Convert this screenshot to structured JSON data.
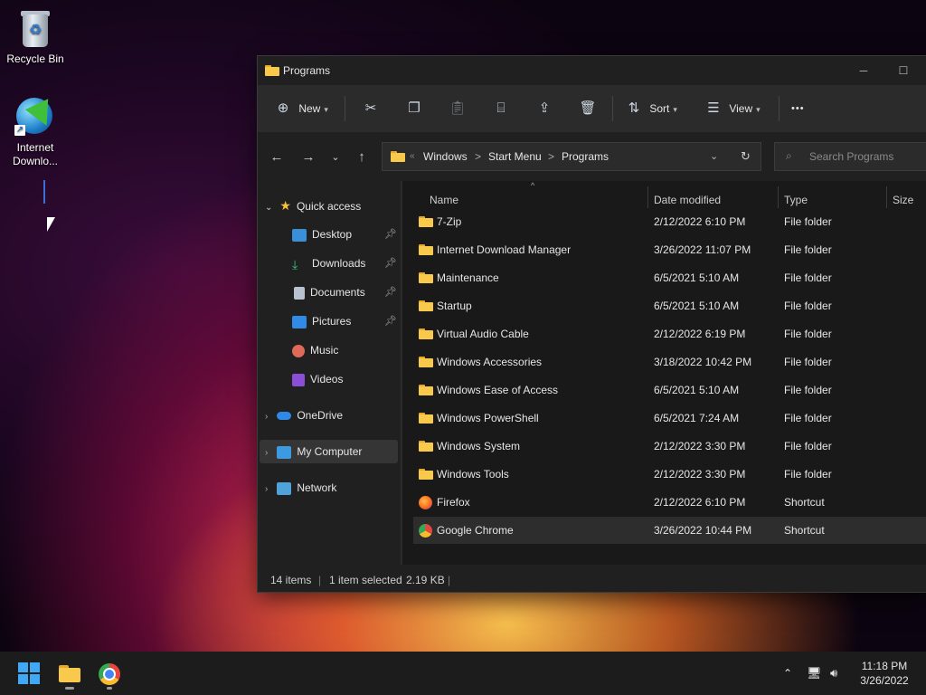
{
  "desktop": {
    "icons": [
      {
        "label": "Recycle Bin"
      },
      {
        "label": "Internet Downlo..."
      }
    ]
  },
  "window": {
    "title": "Programs",
    "toolbar": {
      "new_label": "New",
      "sort_label": "Sort",
      "view_label": "View",
      "more_label": "•••"
    },
    "address": {
      "overflow": "«",
      "crumbs": [
        "Windows",
        "Start Menu",
        "Programs"
      ],
      "separator": ">"
    },
    "search": {
      "placeholder": "Search Programs"
    },
    "sidebar": {
      "quick_access": "Quick access",
      "items": [
        {
          "label": "Desktop",
          "pinned": true
        },
        {
          "label": "Downloads",
          "pinned": true
        },
        {
          "label": "Documents",
          "pinned": true
        },
        {
          "label": "Pictures",
          "pinned": true
        },
        {
          "label": "Music",
          "pinned": false
        },
        {
          "label": "Videos",
          "pinned": false
        }
      ],
      "onedrive": "OneDrive",
      "my_computer": "My Computer",
      "network": "Network"
    },
    "columns": {
      "name": "Name",
      "date": "Date modified",
      "type": "Type",
      "size": "Size"
    },
    "rows": [
      {
        "name": "7-Zip",
        "date": "2/12/2022 6:10 PM",
        "type": "File folder"
      },
      {
        "name": "Internet Download Manager",
        "date": "3/26/2022 11:07 PM",
        "type": "File folder"
      },
      {
        "name": "Maintenance",
        "date": "6/5/2021 5:10 AM",
        "type": "File folder"
      },
      {
        "name": "Startup",
        "date": "6/5/2021 5:10 AM",
        "type": "File folder"
      },
      {
        "name": "Virtual Audio Cable",
        "date": "2/12/2022 6:19 PM",
        "type": "File folder"
      },
      {
        "name": "Windows Accessories",
        "date": "3/18/2022 10:42 PM",
        "type": "File folder"
      },
      {
        "name": "Windows Ease of Access",
        "date": "6/5/2021 5:10 AM",
        "type": "File folder"
      },
      {
        "name": "Windows PowerShell",
        "date": "6/5/2021 7:24 AM",
        "type": "File folder"
      },
      {
        "name": "Windows System",
        "date": "2/12/2022 3:30 PM",
        "type": "File folder"
      },
      {
        "name": "Windows Tools",
        "date": "2/12/2022 3:30 PM",
        "type": "File folder"
      },
      {
        "name": "Firefox",
        "date": "2/12/2022 6:10 PM",
        "type": "Shortcut"
      },
      {
        "name": "Google Chrome",
        "date": "3/26/2022 10:44 PM",
        "type": "Shortcut"
      }
    ],
    "status": {
      "count": "14 items",
      "selected": "1 item selected",
      "size": "2.19 KB"
    }
  },
  "taskbar": {
    "time": "11:18 PM",
    "date": "3/26/2022"
  },
  "colors": {
    "folder": "#f8c94a",
    "accent": "#60cdff",
    "window_bg": "#202020",
    "selected_row": "#2d2d2d"
  }
}
